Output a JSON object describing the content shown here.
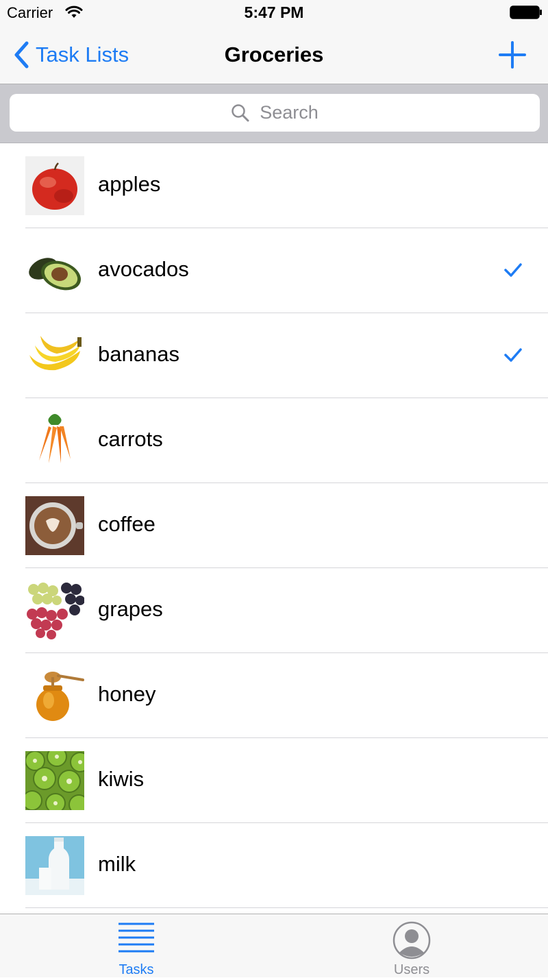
{
  "status_bar": {
    "carrier": "Carrier",
    "time": "5:47 PM"
  },
  "nav": {
    "back_label": "Task Lists",
    "title": "Groceries"
  },
  "search": {
    "placeholder": "Search"
  },
  "accent_color": "#1e7cf4",
  "tasks": [
    {
      "label": "apples",
      "checked": false,
      "icon": "apple-image"
    },
    {
      "label": "avocados",
      "checked": true,
      "icon": "avocado-image"
    },
    {
      "label": "bananas",
      "checked": true,
      "icon": "banana-image"
    },
    {
      "label": "carrots",
      "checked": false,
      "icon": "carrot-image"
    },
    {
      "label": "coffee",
      "checked": false,
      "icon": "coffee-image"
    },
    {
      "label": "grapes",
      "checked": false,
      "icon": "grapes-image"
    },
    {
      "label": "honey",
      "checked": false,
      "icon": "honey-image"
    },
    {
      "label": "kiwis",
      "checked": false,
      "icon": "kiwi-image"
    },
    {
      "label": "milk",
      "checked": false,
      "icon": "milk-image"
    }
  ],
  "tab_bar": {
    "tasks_label": "Tasks",
    "users_label": "Users",
    "selected": "Tasks"
  }
}
